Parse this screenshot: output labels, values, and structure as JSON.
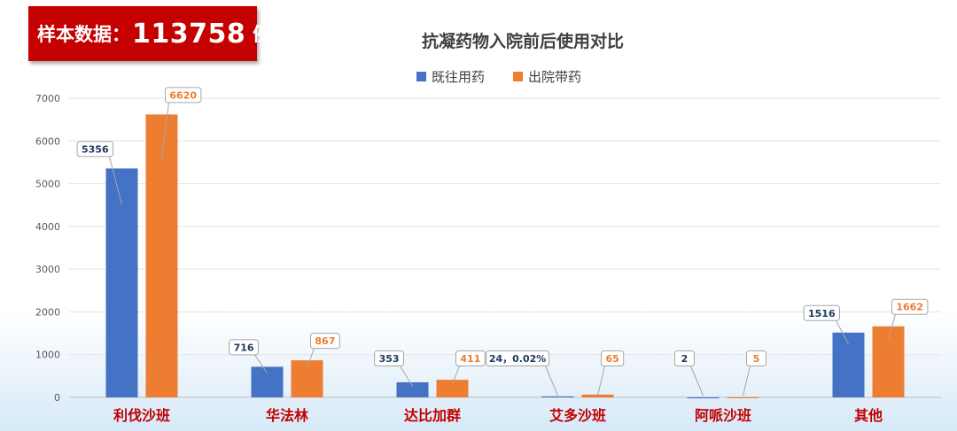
{
  "badge": {
    "label": "样本数据：",
    "value": "113758",
    "unit": "例"
  },
  "colors": {
    "series1": "#4472c4",
    "series2": "#ed7d31",
    "category_label": "#c00000",
    "axis_text": "#595959",
    "grid": "#e3e3e3",
    "label1_text": "#1f3864",
    "label2_text": "#ed7d31"
  },
  "chart_data": {
    "type": "bar",
    "title": "抗凝药物入院前后使用对比",
    "categories": [
      "利伐沙班",
      "华法林",
      "达比加群",
      "艾多沙班",
      "阿哌沙班",
      "其他"
    ],
    "series": [
      {
        "name": "既往用药",
        "values": [
          5356,
          716,
          353,
          24,
          2,
          1516
        ],
        "labels": [
          "5356",
          "716",
          "353",
          "24，0.02%",
          "2",
          "1516"
        ]
      },
      {
        "name": "出院带药",
        "values": [
          6620,
          867,
          411,
          65,
          5,
          1662
        ],
        "labels": [
          "6620",
          "867",
          "411",
          "65",
          "5",
          "1662"
        ]
      }
    ],
    "ylim": [
      0,
      7000
    ],
    "yticks": [
      "0",
      "1000",
      "2000",
      "3000",
      "4000",
      "5000",
      "6000",
      "7000"
    ],
    "grid": true,
    "legend": "top"
  }
}
